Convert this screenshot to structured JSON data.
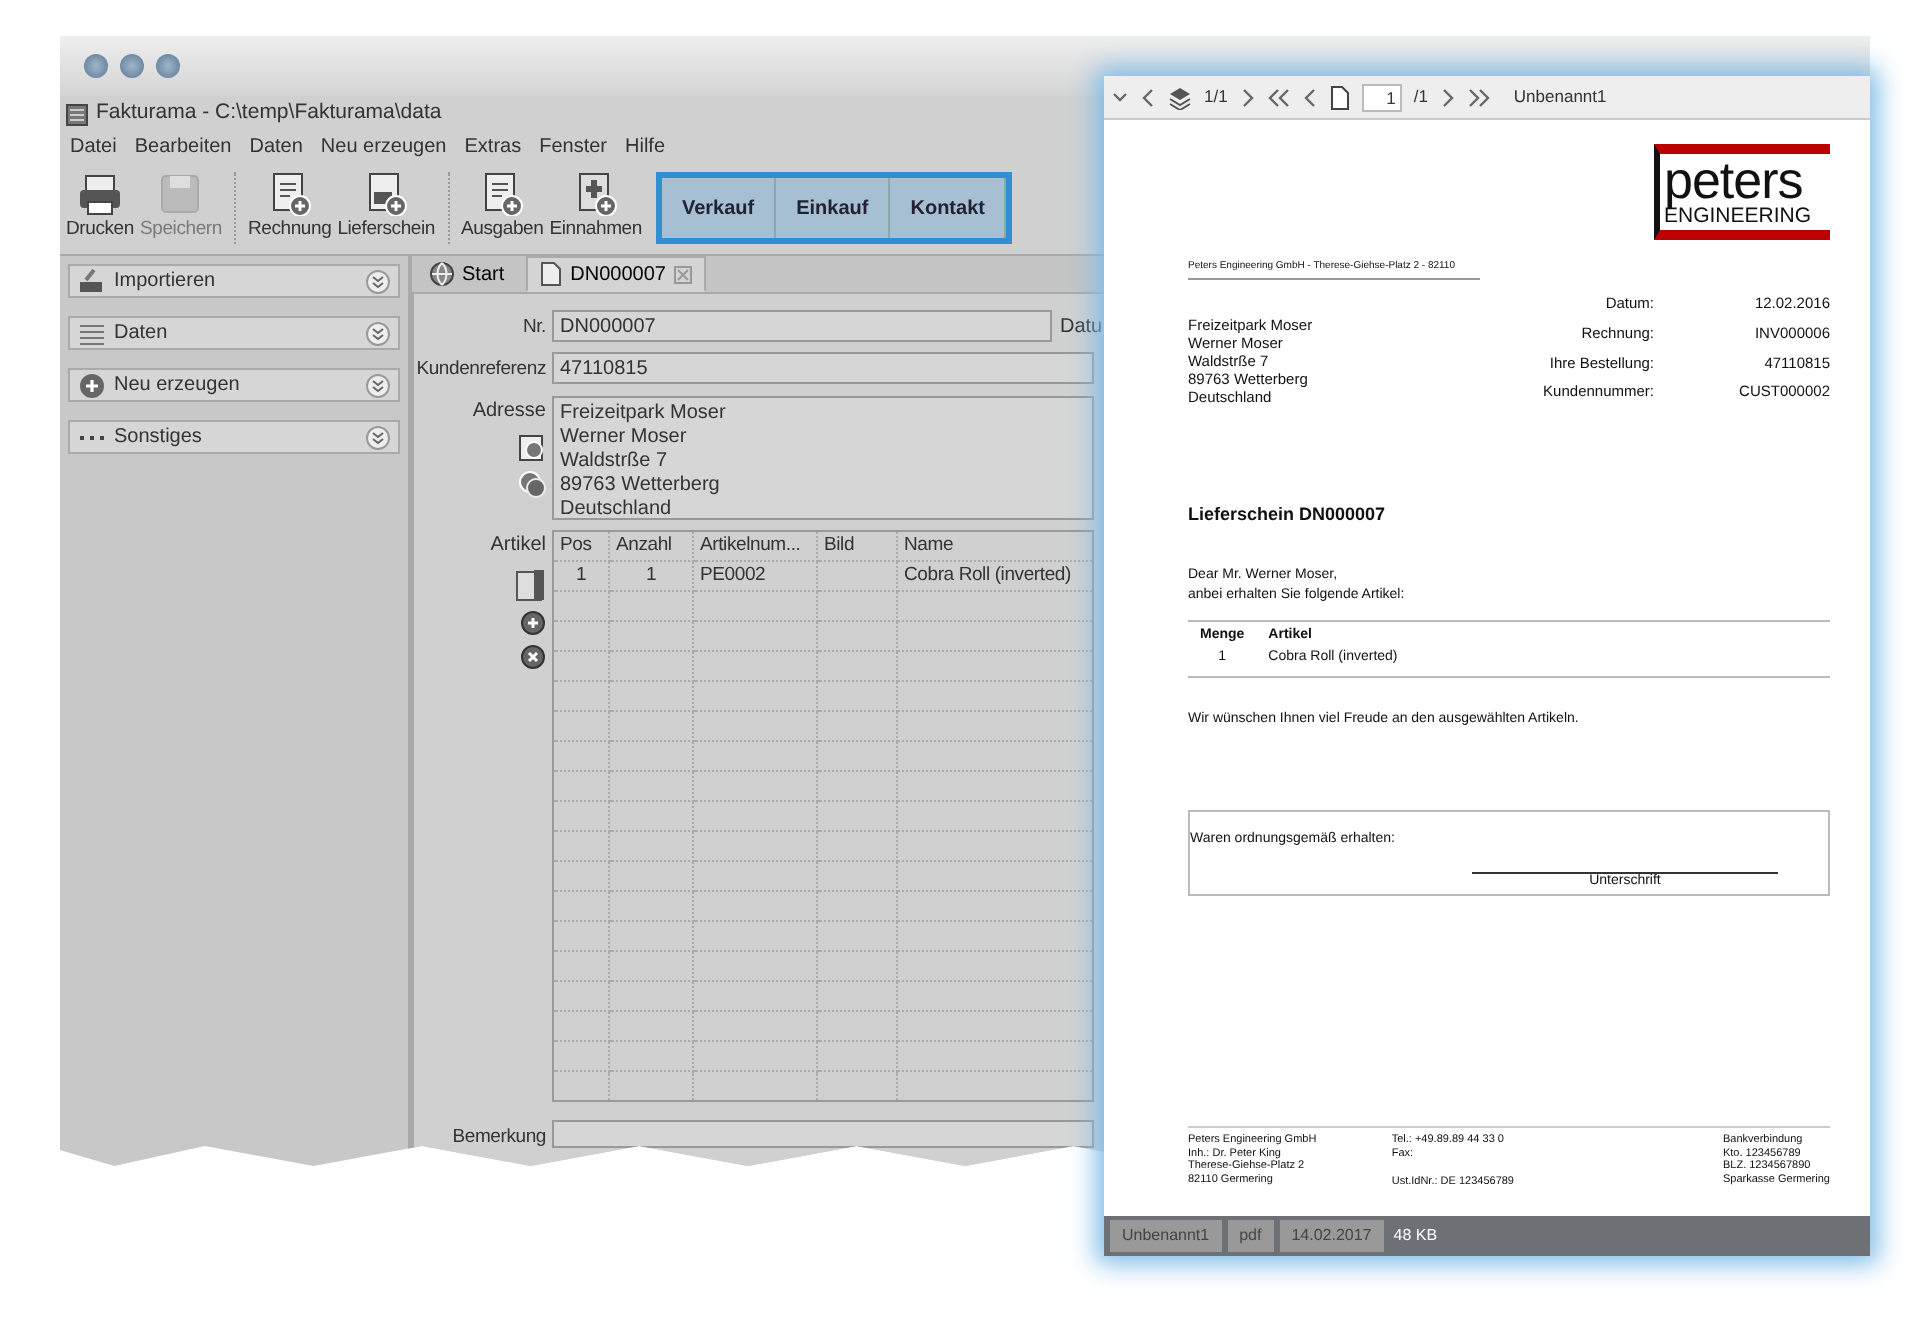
{
  "window": {
    "title": "Fakturama - C:\\temp\\Fakturama\\data"
  },
  "menu": [
    "Datei",
    "Bearbeiten",
    "Daten",
    "Neu erzeugen",
    "Extras",
    "Fenster",
    "Hilfe"
  ],
  "toolbar_groups": [
    [
      {
        "label": "Drucken",
        "kind": "printer",
        "disabled": false
      },
      {
        "label": "Speichern",
        "kind": "disk",
        "disabled": true
      }
    ],
    [
      {
        "label": "Rechnung",
        "kind": "invoice",
        "disabled": false
      },
      {
        "label": "Lieferschein",
        "kind": "delivery",
        "disabled": false
      }
    ],
    [
      {
        "label": "Ausgaben",
        "kind": "invoice",
        "disabled": false
      },
      {
        "label": "Einnahmen",
        "kind": "income",
        "disabled": false
      }
    ]
  ],
  "quick_buttons": [
    "Verkauf",
    "Einkauf",
    "Kontakt"
  ],
  "sidebar": [
    {
      "label": "Importieren",
      "kind": "import"
    },
    {
      "label": "Daten",
      "kind": "list"
    },
    {
      "label": "Neu erzeugen",
      "kind": "plus"
    },
    {
      "label": "Sonstiges",
      "kind": "dots"
    }
  ],
  "tabs": [
    {
      "label": "Start",
      "kind": "globe",
      "selected": false,
      "closable": false
    },
    {
      "label": "DN000007",
      "kind": "doc",
      "selected": true,
      "closable": true
    }
  ],
  "form": {
    "nr_label": "Nr.",
    "nr": "DN000007",
    "date_label": "Datu",
    "ref_label": "Kundenreferenz",
    "ref": "47110815",
    "address_label": "Adresse",
    "address": [
      "Freizeitpark Moser",
      "Werner Moser",
      "Waldstrße 7",
      "89763 Wetterberg",
      "Deutschland"
    ],
    "items_label": "Artikel",
    "remark_label": "Bemerkung"
  },
  "table": {
    "columns": [
      "Pos",
      "Anzahl",
      "Artikelnum...",
      "Bild",
      "Name"
    ],
    "rows": [
      [
        "1",
        "1",
        "PE0002",
        "",
        "Cobra Roll (inverted)"
      ]
    ]
  },
  "viewer": {
    "pages": "1/1",
    "page_input": "1",
    "page_total": "/1",
    "doc_name": "Unbenannt1",
    "document": {
      "logo": [
        "peters",
        "ENGINEERING"
      ],
      "sender": "Peters Engineering GmbH - Therese-Giehse-Platz 2 - 82110",
      "recipient": [
        "Freizeitpark Moser",
        "Werner Moser",
        "Waldstrße 7",
        "89763 Wetterberg",
        "Deutschland"
      ],
      "meta": [
        {
          "label": "Datum:",
          "value": "12.02.2016"
        },
        {
          "label": "Rechnung:",
          "value": "INV000006"
        },
        {
          "label": "Ihre Bestellung:",
          "value": "47110815"
        },
        {
          "label": "Kundennummer:",
          "value": "CUST000002"
        }
      ],
      "title": "Lieferschein DN000007",
      "greeting": [
        "Dear Mr. Werner Moser,",
        "anbei erhalten Sie folgende Artikel:"
      ],
      "items_columns": [
        "Menge",
        "Artikel"
      ],
      "items": [
        [
          "1",
          "Cobra Roll (inverted)"
        ]
      ],
      "closing": "Wir wünschen Ihnen viel Freude an den ausgewählten Artikeln.",
      "receipt": "Waren ordnungsgemäß erhalten:",
      "signature": "Unterschrift",
      "footer": [
        {
          "lines": [
            "Peters Engineering GmbH",
            "Inh.: Dr. Peter King",
            "Therese-Giehse-Platz 2",
            "82110 Germering"
          ]
        },
        {
          "lines": [
            "Tel.: +49.89.89 44 33 0",
            "Fax:"
          ],
          "last": "Ust.IdNr.: DE 123456789"
        },
        {
          "lines": [
            "Bankverbindung",
            "Kto. 123456789",
            "BLZ. 1234567890",
            "Sparkasse Germering"
          ]
        }
      ]
    },
    "status": [
      "Unbenannt1",
      "pdf",
      "14.02.2017"
    ],
    "size": "48 KB"
  }
}
